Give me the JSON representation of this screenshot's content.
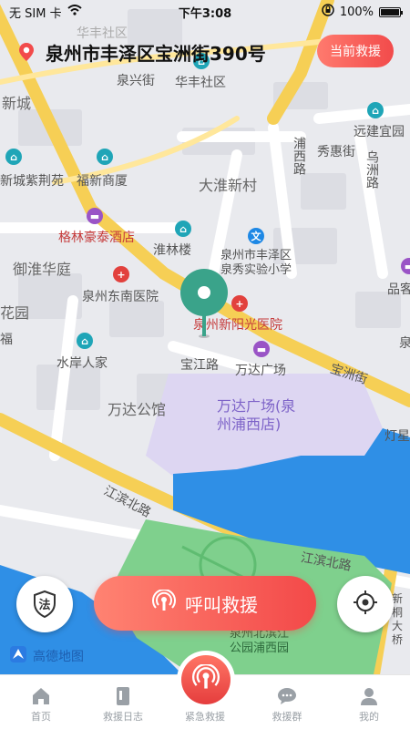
{
  "status_bar": {
    "carrier": "无 SIM 卡",
    "time": "下午3:08",
    "battery": "100%",
    "battery_level": 1.0
  },
  "header": {
    "address": "泉州市丰泽区宝洲街390号",
    "current_rescue_label": "当前救援"
  },
  "map": {
    "labels": {
      "huafeng_top": "华丰社区",
      "huafeng": "华丰社区",
      "xingjie": "泉兴街",
      "xinchen": "新城",
      "yuanjian": "远建宜园",
      "xinchengzijingyuan": "新城紫荆苑",
      "fuxin": "福新商厦",
      "puxi": "浦西路",
      "xiuhui": "秀惠街",
      "wuzhou": "乌洲路",
      "dahuai": "大淮新村",
      "gelin": "格林豪泰酒店",
      "huailin": "淮林楼",
      "school": "泉州市丰泽区\n泉秀实验小学",
      "yuhuai": "御淮华庭",
      "hospital_dongnan": "泉州东南医院",
      "hospital_xinyang": "泉州新阳光医院",
      "pinke": "品客",
      "huayuan": "花园",
      "fu": "福",
      "shuian": "水岸人家",
      "baojiang": "宝江路",
      "wanda_plaza": "万达广场",
      "baozhou": "宝洲街",
      "wanda_gongguan": "万达公馆",
      "wanda_center": "万达广场(泉\n州浦西店)",
      "dengxing": "灯星",
      "jiangbin_left": "江滨北路",
      "jiangbin_right": "江滨北路",
      "park": "泉州北滨江\n公园浦西园",
      "xinqiao": "新\n桐\n大\n桥",
      "quan": "泉"
    },
    "credit": "高德地图"
  },
  "buttons": {
    "law_label": "法",
    "call_rescue": "呼叫救援"
  },
  "tabs": [
    {
      "label": "首页"
    },
    {
      "label": "救援日志"
    },
    {
      "label": "紧急救援"
    },
    {
      "label": "救援群"
    },
    {
      "label": "我的"
    }
  ],
  "colors": {
    "accent": "#f24b4b",
    "road_yellow": "#f7d35a",
    "water": "#2f8fe6",
    "park": "#76cf8a",
    "pin": "#3aa38a"
  }
}
